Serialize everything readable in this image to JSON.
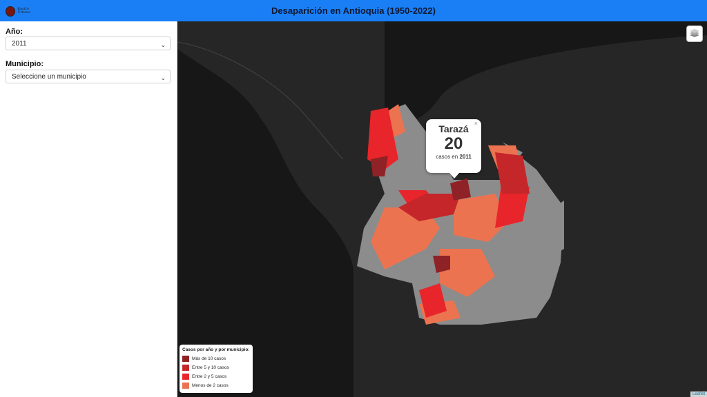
{
  "header": {
    "title": "Desaparición en Antioquia (1950-2022)",
    "logo_text": "Rastro Urbano",
    "color": "#1a7ff5"
  },
  "sidebar": {
    "year_label": "Año:",
    "year_value": "2011",
    "municipio_label": "Municipio:",
    "municipio_placeholder": "Seleccione un municipio"
  },
  "popup": {
    "name": "Tarazá",
    "count": "20",
    "subtitle_prefix": "casos en",
    "year": "2011",
    "close": "×"
  },
  "legend": {
    "title": "Casos por año y por municipio:",
    "items": [
      {
        "label": "Más de 10 casos",
        "color": "#8f2226"
      },
      {
        "label": "Entre 5 y 10 casos",
        "color": "#c4262a"
      },
      {
        "label": "Entre 2 y 5 casos",
        "color": "#e8252a"
      },
      {
        "label": "Menos de 2 casos",
        "color": "#ec7350"
      }
    ]
  },
  "attribution": "Leaflet",
  "colors": {
    "no_data": "#8c8c8c",
    "land": "#262626",
    "sea": "#171717"
  }
}
